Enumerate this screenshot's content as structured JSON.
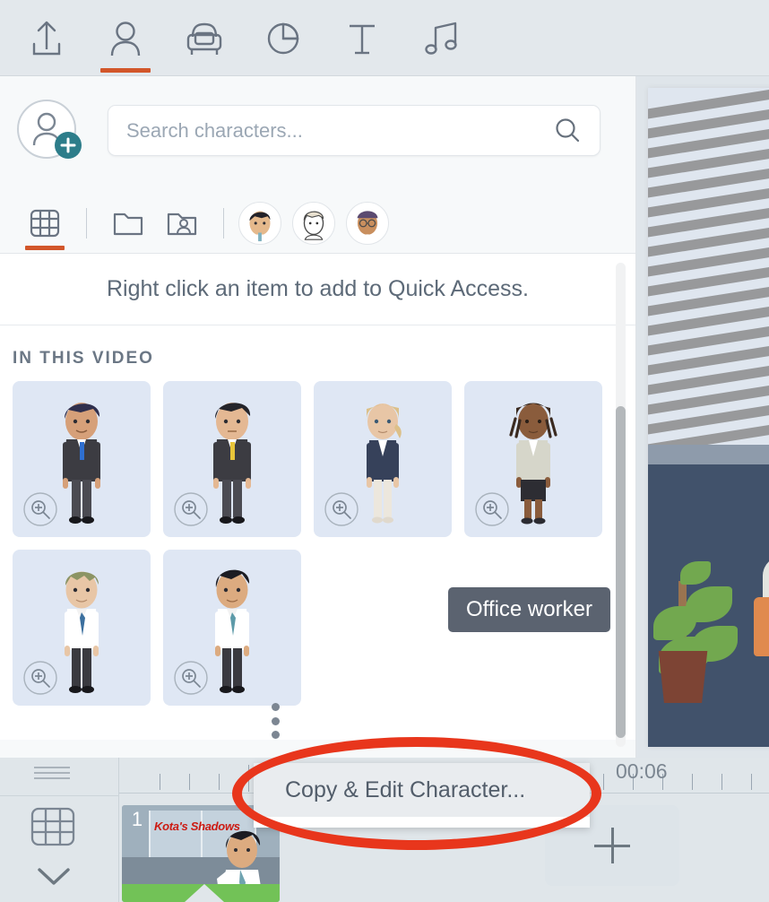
{
  "app": {
    "accent_color": "#d2562a",
    "teal_color": "#2d7d8a",
    "annotation_color": "#e8361c",
    "panel_bg": "#f7f9fa",
    "card_bg": "#dfe7f4"
  },
  "toolbar": {
    "items": [
      {
        "name": "upload-icon",
        "label": "Upload"
      },
      {
        "name": "character-icon",
        "label": "Characters",
        "active": true
      },
      {
        "name": "prop-icon",
        "label": "Props"
      },
      {
        "name": "chart-icon",
        "label": "Charts"
      },
      {
        "name": "text-icon",
        "label": "Text"
      },
      {
        "name": "audio-icon",
        "label": "Audio"
      }
    ]
  },
  "library": {
    "add_character_label": "Add character",
    "search": {
      "placeholder": "Search characters...",
      "value": "",
      "icon": "search-icon"
    },
    "subtabs": [
      {
        "name": "all-characters-tab",
        "icon": "grid-icon",
        "active": true
      },
      {
        "name": "folders-tab",
        "icon": "folder-icon",
        "active": false
      },
      {
        "name": "my-characters-tab",
        "icon": "folder-person-icon",
        "active": false
      }
    ],
    "quick_access_avatars": [
      {
        "name": "avatar-dark-hair-man"
      },
      {
        "name": "avatar-sketch-man"
      },
      {
        "name": "avatar-glasses-man"
      }
    ],
    "quick_access_hint": "Right click an item to add to Quick Access.",
    "section_title": "IN THIS VIDEO",
    "characters": [
      {
        "name": "character-navy-hair-suit-blue-tie",
        "hair": "#2f2f4d",
        "skin": "#d6a079",
        "jacket": "#3c3c42",
        "tie": "#2f6fd0",
        "shirt": "#ffffff",
        "legs": "#4b4b52"
      },
      {
        "name": "character-black-hair-suit-yellow-tie",
        "hair": "#24242a",
        "skin": "#e4b893",
        "jacket": "#3c3c42",
        "tie": "#e8c53a",
        "shirt": "#ffffff",
        "legs": "#4b4b52"
      },
      {
        "name": "character-blonde-woman-navy-blazer",
        "hair": "#dcc089",
        "skin": "#e8c6a6",
        "jacket": "#36415a",
        "tie": "",
        "shirt": "#ffffff",
        "legs": "#ece7dd"
      },
      {
        "name": "character-braids-woman-light-blazer",
        "hair": "#3a2a20",
        "skin": "#8a5c3c",
        "jacket": "#d6d6ca",
        "tie": "",
        "shirt": "#ffffff",
        "legs": "#2d2d33"
      },
      {
        "name": "character-green-hair-man-blue-tie",
        "hair": "#8c9464",
        "skin": "#e8c6a6",
        "jacket": "#ffffff",
        "tie": "#3b6f9e",
        "shirt": "#ffffff",
        "legs": "#3a3a40"
      },
      {
        "name": "character-black-hair-man-teal-tie",
        "hair": "#1c1c22",
        "skin": "#dcab80",
        "jacket": "#ffffff",
        "tie": "#5d9aa8",
        "shirt": "#ffffff",
        "legs": "#3a3a40"
      }
    ],
    "zoom_button_label": "Preview",
    "more_menu_label": "More options",
    "tooltip": "Office worker"
  },
  "context_menu": {
    "items": [
      {
        "name": "copy-and-edit-character-item",
        "label": "Copy & Edit Character...",
        "hovered": true
      }
    ]
  },
  "timeline": {
    "ruler_label": "00:06",
    "scene": {
      "number": "1",
      "title": "Kota's Shadows"
    },
    "add_scene_label": "Add scene",
    "grid_view_label": "Scene grid",
    "collapse_label": "Collapse"
  },
  "stage": {
    "name": "canvas-preview",
    "description": "Office scene"
  }
}
